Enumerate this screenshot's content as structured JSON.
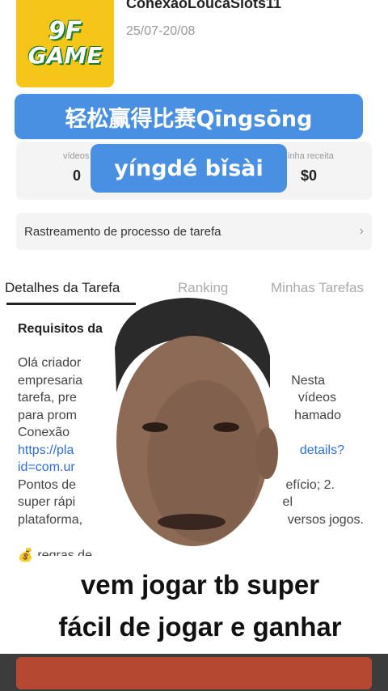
{
  "header": {
    "app_logo_line1": "9F",
    "app_logo_line2": "GAME",
    "account_name": "ConexaoLoucaSlots11",
    "date_range": "25/07-20/08"
  },
  "stats": {
    "videos_label": "vídeos",
    "videos_value": "0",
    "revenue_label": "inha receita",
    "revenue_value": "$0"
  },
  "captions": {
    "top_line1": "轻松赢得比赛Qīngsōng",
    "top_line2": "yíngdé bǐsài",
    "bottom_line1": "vem jogar  tb super",
    "bottom_line2": "fácil de jogar e ganhar"
  },
  "tracking": {
    "label": "Rastreamento de processo de tarefa"
  },
  "tabs": [
    {
      "label": "Detalhes da Tarefa"
    },
    {
      "label": "Ranking"
    },
    {
      "label": "Minhas Tarefas"
    }
  ],
  "task": {
    "requirements_title": "Requisitos da",
    "line1_a": "Olá criador",
    "line2_a": "empresaria",
    "line2_b": "Nesta",
    "line3_a": "tarefa, pre",
    "line3_b": "vídeos",
    "line4_a": "para prom",
    "line4_b": "hamado",
    "line5_a": "Conexão",
    "link1_a": "https://pla",
    "link1_b": "details?",
    "link2_a": "id=com.ur",
    "line8_a": "Pontos de",
    "line8_b": "efício; 2.",
    "line9_a": "super rápi",
    "line9_b": "el",
    "line10_a": "plataforma,",
    "line10_b": "versos jogos.",
    "rules_label": "regras de"
  },
  "icons": {
    "money_bag": "money-bag-icon",
    "chevron": "chevron-right-icon"
  },
  "colors": {
    "accent_blue": "#4a90e2",
    "logo_yellow": "#f5c518",
    "link_blue": "#2f6fd6"
  }
}
